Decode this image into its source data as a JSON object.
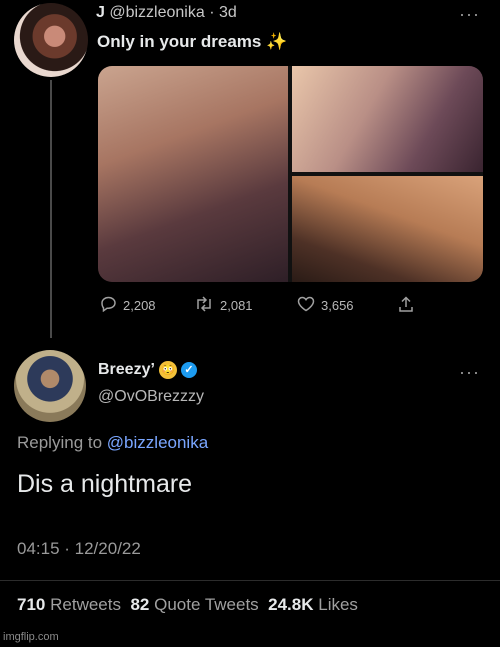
{
  "original_tweet": {
    "name": "J",
    "handle": "@bizzleonika",
    "age": "3d",
    "more": "···",
    "text": "Only in your dreams ✨",
    "actions": {
      "replies": "2,208",
      "retweets": "2,081",
      "likes": "3,656"
    }
  },
  "reply_tweet": {
    "name": "Breezy’",
    "emoji": "😳",
    "handle": "@OvOBrezzzy",
    "more": "···",
    "replying_prefix": "Replying to",
    "replying_to": "@bizzleonika",
    "text": "Dis a nightmare",
    "timestamp": "04:15 · 12/20/22",
    "stats": {
      "retweets_count": "710",
      "retweets_label": "Retweets",
      "quotes_count": "82",
      "quotes_label": "Quote Tweets",
      "likes_count": "24.8K",
      "likes_label": "Likes"
    }
  },
  "watermark": "imgflip.com",
  "icons": {
    "reply": "reply-icon",
    "retweet": "retweet-icon",
    "like": "heart-icon",
    "share": "share-icon",
    "verified": "verified-badge-icon"
  },
  "colors": {
    "background": "#000000",
    "link": "#7aa6ff",
    "verified": "#1d9bf0"
  }
}
